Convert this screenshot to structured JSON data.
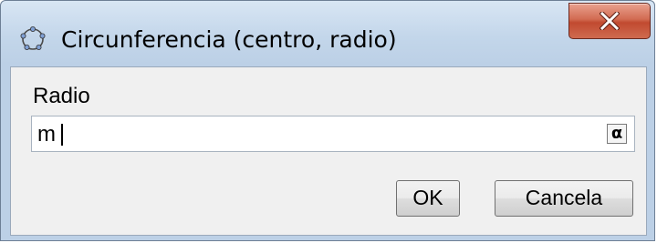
{
  "window": {
    "title": "Circunferencia (centro, radio)",
    "title_icon": "circle-through-points-icon",
    "close_icon": "close-icon"
  },
  "form": {
    "label": "Radio",
    "input_value": "m",
    "alpha_button": "α"
  },
  "buttons": {
    "ok": "OK",
    "cancel": "Cancela"
  },
  "colors": {
    "titlebar": "#c3d6ea",
    "close_button": "#c14a30",
    "client_bg": "#f0f0f0"
  }
}
